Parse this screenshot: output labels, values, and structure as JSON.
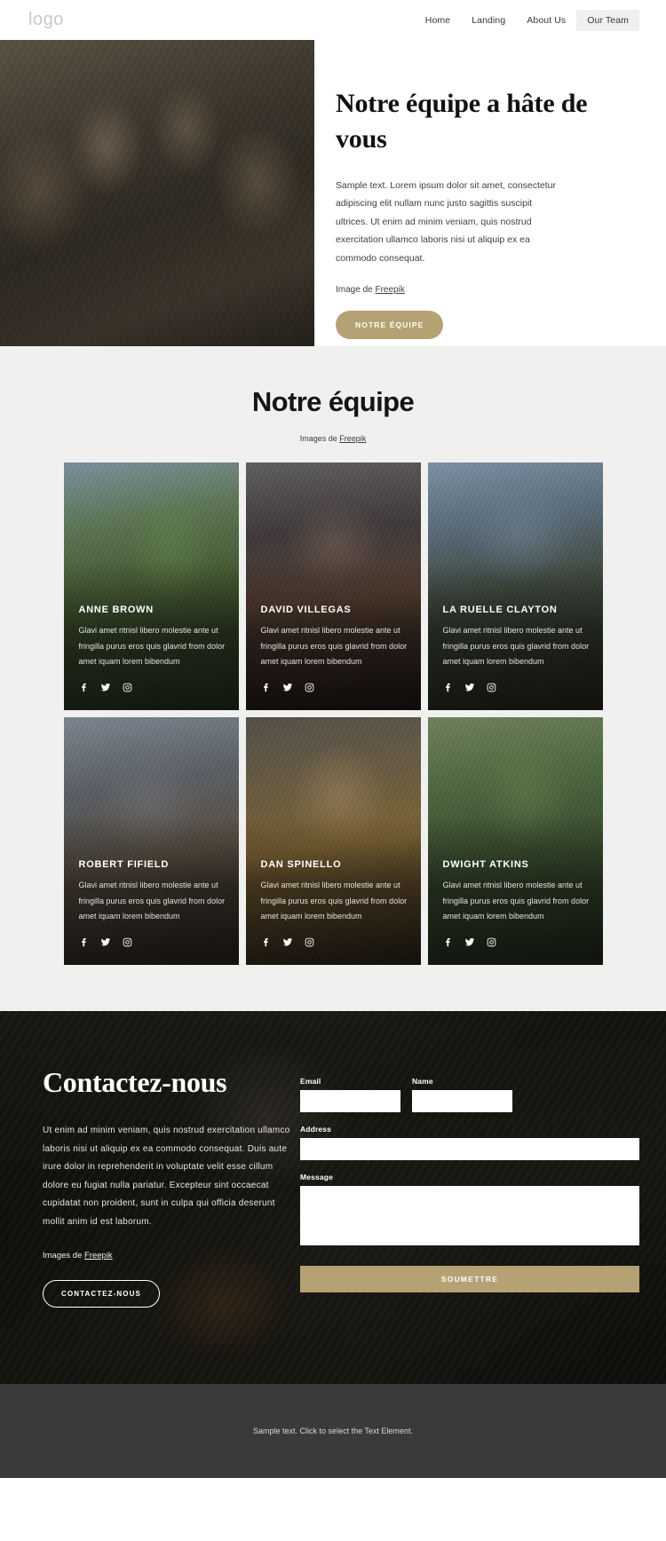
{
  "header": {
    "logo": "logo",
    "nav": [
      {
        "label": "Home",
        "active": false
      },
      {
        "label": "Landing",
        "active": false
      },
      {
        "label": "About Us",
        "active": false
      },
      {
        "label": "Our Team",
        "active": true
      }
    ]
  },
  "hero": {
    "title": "Notre équipe a hâte de vous",
    "paragraph": "Sample text. Lorem ipsum dolor sit amet, consectetur adipiscing elit nullam nunc justo sagittis suscipit ultrices. Ut enim ad minim veniam, quis nostrud exercitation ullamco laboris nisi ut aliquip ex ea commodo consequat.",
    "credit_prefix": "Image de ",
    "credit_link": "Freepik",
    "button": "NOTRE ÉQUIPE",
    "image_alt": "group-of-friends-camping"
  },
  "team": {
    "title": "Notre équipe",
    "credit_prefix": "Images de ",
    "credit_link": "Freepik",
    "members": [
      {
        "name": "ANNE BROWN",
        "desc": "Glavi amet ritnisl libero molestie ante ut fringilla purus eros quis glavrid from dolor amet iquam lorem bibendum",
        "socials": [
          "facebook-icon",
          "twitter-icon",
          "instagram-icon"
        ]
      },
      {
        "name": "DAVID VILLEGAS",
        "desc": "Glavi amet ritnisl libero molestie ante ut fringilla purus eros quis glavrid from dolor amet iquam lorem bibendum",
        "socials": [
          "facebook-icon",
          "twitter-icon",
          "instagram-icon"
        ]
      },
      {
        "name": "LA RUELLE CLAYTON",
        "desc": "Glavi amet ritnisl libero molestie ante ut fringilla purus eros quis glavrid from dolor amet iquam lorem bibendum",
        "socials": [
          "facebook-icon",
          "twitter-icon",
          "instagram-icon"
        ]
      },
      {
        "name": "ROBERT FIFIELD",
        "desc": "Glavi amet ritnisl libero molestie ante ut fringilla purus eros quis glavrid from dolor amet iquam lorem bibendum",
        "socials": [
          "facebook-icon",
          "twitter-icon",
          "instagram-icon"
        ]
      },
      {
        "name": "DAN SPINELLO",
        "desc": "Glavi amet ritnisl libero molestie ante ut fringilla purus eros quis glavrid from dolor amet iquam lorem bibendum",
        "socials": [
          "facebook-icon",
          "twitter-icon",
          "instagram-icon"
        ]
      },
      {
        "name": "DWIGHT ATKINS",
        "desc": "Glavi amet ritnisl libero molestie ante ut fringilla purus eros quis glavrid from dolor amet iquam lorem bibendum",
        "socials": [
          "facebook-icon",
          "twitter-icon",
          "instagram-icon"
        ]
      }
    ]
  },
  "contact": {
    "title": "Contactez-nous",
    "paragraph": "Ut enim ad minim veniam, quis nostrud exercitation ullamco laboris nisi ut aliquip ex ea commodo consequat. Duis aute irure dolor in reprehenderit in voluptate velit esse cillum dolore eu fugiat nulla pariatur. Excepteur sint occaecat cupidatat non proident, sunt in culpa qui officia deserunt mollit anim id est laborum.",
    "credit_prefix": "Images de ",
    "credit_link": "Freepik",
    "button": "CONTACTEZ-NOUS",
    "form": {
      "email_label": "Email",
      "email_value": "",
      "email_placeholder": "",
      "name_label": "Name",
      "name_value": "",
      "name_placeholder": "",
      "address_label": "Address",
      "address_value": "",
      "address_placeholder": "",
      "message_label": "Message",
      "message_value": "",
      "message_placeholder": "",
      "submit_label": "SOUMETTRE"
    }
  },
  "footer": {
    "text": "Sample text. Click to select the Text Element."
  },
  "colors": {
    "accent_tan": "#b5a274",
    "section_bg": "#f0f0ef",
    "footer_bg": "#3a3a3a",
    "nav_active_bg": "#f0f0f0"
  }
}
